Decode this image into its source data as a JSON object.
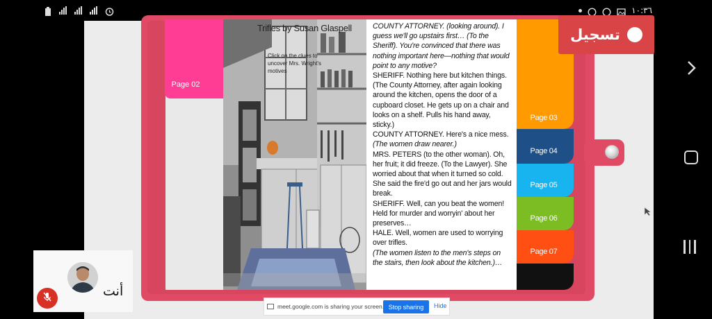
{
  "status_bar": {
    "time": "١٠:٣٦",
    "left_icons": [
      "battery-icon",
      "signal-icon",
      "data-signal-icon",
      "signal-icon",
      "alarm-icon"
    ],
    "right_icons": [
      "notification-dot-icon",
      "whatsapp-icon",
      "whatsapp-icon",
      "gallery-icon"
    ]
  },
  "recording": {
    "label": "تسجيل"
  },
  "book": {
    "left_tab": {
      "label": "Page 02",
      "color": "#ff3d94"
    },
    "image": {
      "title": "Trifles by Susan Glaspell",
      "hint": "Click on the clues to uncover Mrs. Wright's motives"
    },
    "script_lines": [
      {
        "t": "COUNTY ATTORNEY. (looking around). I guess we'll go upstairs first… (To the Sheriff). You're convinced that there was nothing important here—nothing that would point to any motive?",
        "italic": "partial"
      },
      {
        "t": "SHERIFF. Nothing here but kitchen things."
      },
      {
        "t": "(The County Attorney, after again looking around the kitchen, opens the door of a cupboard closet. He gets up on a chair and looks on a shelf. Pulls his hand away, sticky.)"
      },
      {
        "t": "COUNTY ATTORNEY. Here's a nice mess."
      },
      {
        "t": "(The women draw nearer.)"
      },
      {
        "t": "MRS. PETERS (to the other woman). Oh, her fruit; it did freeze. (To the Lawyer). She worried about that when it turned so cold. She said the fire'd go out and her jars would break."
      },
      {
        "t": "SHERIFF. Well, can you beat the women! Held for murder and worryin' about her preserves…"
      },
      {
        "t": "HALE. Well, women are used to worrying over trifles."
      },
      {
        "t": "(The women listen to the men's steps on the stairs, then look about the kitchen.)…"
      }
    ],
    "tabs": [
      {
        "label": "Page 03",
        "color": "#ff9a00"
      },
      {
        "label": "Page 04",
        "color": "#1e4f86"
      },
      {
        "label": "Page 05",
        "color": "#18b4ef"
      },
      {
        "label": "Page 06",
        "color": "#7bbd22"
      },
      {
        "label": "Page 07",
        "color": "#ff4f13"
      },
      {
        "label": "",
        "color": "#111111"
      }
    ],
    "frame_color": "#e04a64"
  },
  "self_view": {
    "label": "أنت",
    "mic_state": "muted"
  },
  "share_bar": {
    "message": "meet.google.com is sharing your screen.",
    "stop_label": "Stop sharing",
    "hide_label": "Hide"
  }
}
